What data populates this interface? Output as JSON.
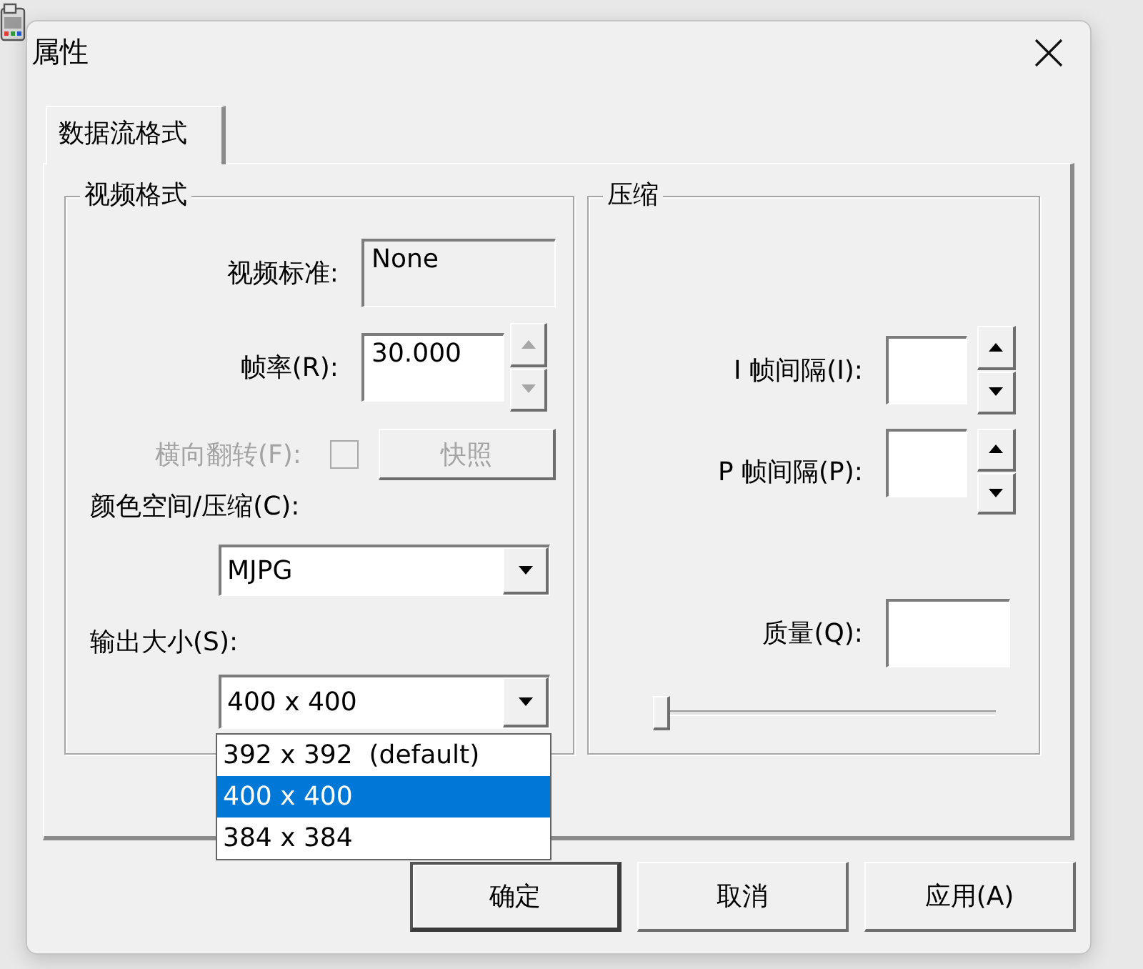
{
  "window": {
    "title": "属性"
  },
  "tabs": [
    {
      "label": "数据流格式",
      "selected": true
    }
  ],
  "video_format": {
    "title": "视频格式",
    "standard": {
      "label": "视频标准:",
      "value": "None"
    },
    "frame_rate": {
      "label": "帧率(R):",
      "value": "30.000",
      "spin_disabled": true
    },
    "flip": {
      "label": "横向翻转(F):",
      "checked": false,
      "disabled": true
    },
    "snapshot": {
      "label": "快照",
      "disabled": true
    },
    "color_space": {
      "label": "颜色空间/压缩(C):",
      "value": "MJPG"
    },
    "output_size": {
      "label": "输出大小(S):",
      "value": "400 x 400",
      "expanded": true,
      "options": [
        {
          "label": "392 x 392  (default)",
          "selected": false
        },
        {
          "label": "400 x 400",
          "selected": true
        },
        {
          "label": "384 x 384",
          "selected": false
        }
      ]
    }
  },
  "compression": {
    "title": "压缩",
    "i_frame_interval": {
      "label": "I 帧间隔(I):",
      "spin_disabled": false
    },
    "p_frame_interval": {
      "label": "P 帧间隔(P):",
      "spin_disabled": false
    },
    "quality": {
      "label": "质量(Q):",
      "level": 0
    }
  },
  "buttons": [
    {
      "label": "确定",
      "default": true
    },
    {
      "label": "取消",
      "default": false
    },
    {
      "label": "应用(A)",
      "default": false
    }
  ]
}
